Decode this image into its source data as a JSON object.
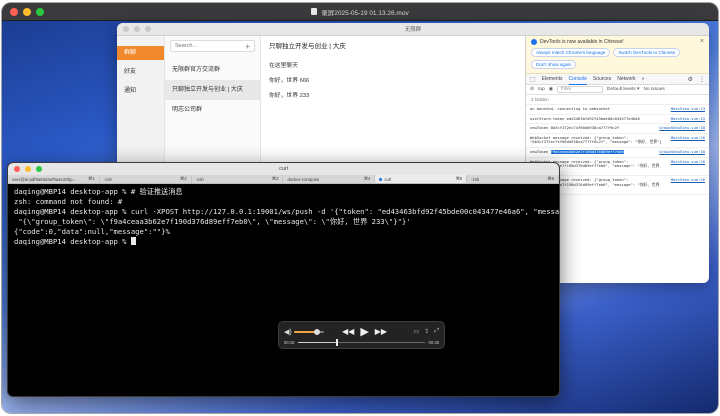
{
  "player": {
    "title": "录屏2025-05-19 01.13.26.mov",
    "time_elapsed": "00:15",
    "time_total": "00:48",
    "volume": 0.75,
    "progress": 0.3
  },
  "app": {
    "title": "无限群",
    "nav": [
      {
        "label": "群聊"
      },
      {
        "label": "好友"
      },
      {
        "label": "通知"
      }
    ],
    "search_placeholder": "Search...",
    "add_symbol": "+",
    "contacts": [
      {
        "label": "无限群官方交流群"
      },
      {
        "label": "只聊独立开发与创业 | 大庆"
      },
      {
        "label": "明志公司群"
      }
    ],
    "chat": {
      "title": "只聊独立开发与创业 | 大庆",
      "messages": [
        "在这里聊天",
        "你好，世界 666",
        "你好，世界 233"
      ]
    }
  },
  "devtools": {
    "banner": "DevTools is now available in Chinese!",
    "btn_match": "Always match Chrome's language",
    "btn_switch": "Switch DevTools to Chinese",
    "btn_dont": "Don't show again",
    "tabs": [
      "Elements",
      "Console",
      "Sources",
      "Network",
      "»"
    ],
    "toolbar_top": "top",
    "filter": "Filter",
    "levels": "Default levels ▾",
    "issues": "No Issues",
    "hidden": "2 hidden",
    "logs": [
      {
        "text": "on mounted, connecting to websocket",
        "src": "MainView.vue:13"
      },
      {
        "text": "userStore.token ed43463bfd92f45bde00c043477e46a6",
        "src": "MainView.vue:15"
      },
      {
        "text": "newToken 0b3cf372ec74f60dd938ca777f9c2f",
        "src": "GroupShowView.vue:18"
      },
      {
        "text": "WebSocket message received: {\"group_token\": \"0b3cf372ec74f60dd938ca777ff6c2f\", \"message\": \"你好, 世界\"}",
        "src": "MainView.vue:26"
      },
      {
        "text": "newToken f9a4ceaa3b62e7f190d376d89eff7eb0",
        "src": "GroupShowView.vue:18",
        "highlight": "f9a4ceaa3b62e7f190d376d89eff7eb0"
      },
      {
        "text": "WebSocket message received: {\"group_token\": \"f9a4ceaa3b62e7f190d376d89eff7eb0\", \"message\": \"你好, 世界 666\"}",
        "src": "MainView.vue:26"
      },
      {
        "text": "WebSocket message received: {\"group_token\": \"f9a4ceaa3b62e7f190d376d89eff7eb0\", \"message\": \"你好, 世界 233\"}",
        "src": "MainView.vue:26"
      }
    ]
  },
  "terminal": {
    "title": "curl",
    "tabs": [
      {
        "label": "user@ai-pdf9a93d4ef9a4e20bp...",
        "shortcut": "⌘1"
      },
      {
        "label": "-zsh",
        "shortcut": "⌘2"
      },
      {
        "label": "-zsh",
        "shortcut": "⌘3"
      },
      {
        "label": "docker-compose",
        "shortcut": "⌘4"
      },
      {
        "label": "curl",
        "shortcut": "⌘5"
      },
      {
        "label": "-zsh",
        "shortcut": "⌘6"
      }
    ],
    "lines": [
      "daqing@MBP14 desktop-app % # 验证推送消息",
      "zsh: command not found: #",
      "daqing@MBP14 desktop-app % curl -XPOST http://127.0.0.1:19001/ws/push -d '{\"token\": \"ed43463bfd92f45bde00c043477e46a6\", \"message\":",
      " \"{\\\"group_token\\\": \\\"f9a4ceaa3b62e7f190d376d89eff7eb0\\\", \\\"message\\\": \\\"你好, 世界 233\\\"}\"}'",
      "{\"code\":0,\"data\":null,\"message\":\"\"}%",
      "daqing@MBP14 desktop-app % "
    ]
  }
}
